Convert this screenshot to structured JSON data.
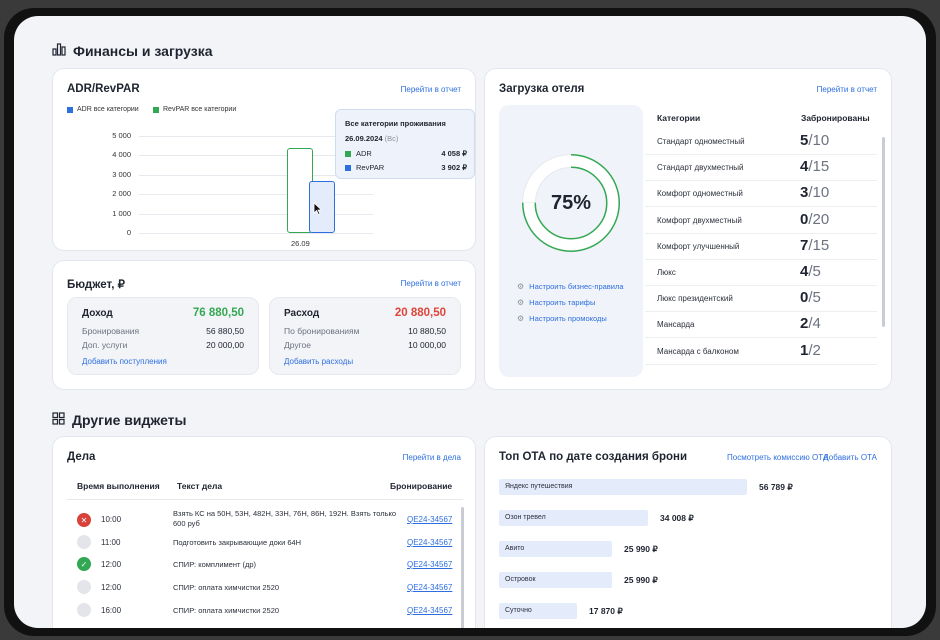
{
  "finance_section": {
    "title": "Финансы и загрузка"
  },
  "adr_card": {
    "title": "ADR/RevPAR",
    "report_link": "Перейти в отчет",
    "legend": [
      {
        "label": "ADR все категории",
        "color": "#2e6fe0"
      },
      {
        "label": "RevPAR все категории",
        "color": "#33a853"
      }
    ],
    "tooltip": {
      "title": "Все категории проживания",
      "date": "26.09.2024",
      "day": "(Вс)",
      "rows": [
        {
          "label": "ADR",
          "value": "4 058 ₽",
          "color": "#33a853"
        },
        {
          "label": "RevPAR",
          "value": "3 902 ₽",
          "color": "#2e6fe0"
        }
      ]
    }
  },
  "chart_data": {
    "type": "bar",
    "categories": [
      "26.09"
    ],
    "series": [
      {
        "name": "RevPAR все категории",
        "values": [
          4400
        ],
        "color": "#33a853"
      },
      {
        "name": "ADR все категории",
        "values": [
          2700
        ],
        "color": "#2e6fe0"
      }
    ],
    "yticks": [
      "5 000",
      "4 000",
      "3 000",
      "2 000",
      "1 000",
      "0"
    ],
    "ylim": [
      0,
      5000
    ]
  },
  "budget_card": {
    "title": "Бюджет, ₽",
    "report_link": "Перейти в отчет",
    "income": {
      "title": "Доход",
      "amount": "76 880,50",
      "rows": [
        {
          "label": "Бронирования",
          "value": "56 880,50"
        },
        {
          "label": "Доп. услуги",
          "value": "20 000,00"
        }
      ],
      "link": "Добавить поступления"
    },
    "expense": {
      "title": "Расход",
      "amount": "20 880,50",
      "rows": [
        {
          "label": "По бронированиям",
          "value": "10 880,50"
        },
        {
          "label": "Другое",
          "value": "10 000,00"
        }
      ],
      "link": "Добавить расходы"
    }
  },
  "occupancy_card": {
    "title": "Загрузка отеля",
    "report_link": "Перейти в отчет",
    "percent_label": "75%",
    "percent_value": 0.75,
    "settings_links": [
      "Настроить бизнес-правила",
      "Настроить тарифы",
      "Настроить промокоды"
    ],
    "col_categories": "Категории",
    "col_booked": "Забронированы",
    "categories": [
      {
        "name": "Стандарт одноместный",
        "booked": "5",
        "total": "/10"
      },
      {
        "name": "Стандарт двухместный",
        "booked": "4",
        "total": "/15"
      },
      {
        "name": "Комфорт одноместный",
        "booked": "3",
        "total": "/10"
      },
      {
        "name": "Комфорт двухместный",
        "booked": "0",
        "total": "/20"
      },
      {
        "name": "Комфорт улучшенный",
        "booked": "7",
        "total": "/15"
      },
      {
        "name": "Люкс",
        "booked": "4",
        "total": "/5"
      },
      {
        "name": "Люкс президентский",
        "booked": "0",
        "total": "/5"
      },
      {
        "name": "Мансарда",
        "booked": "2",
        "total": "/4"
      },
      {
        "name": "Мансарда с балконом",
        "booked": "1",
        "total": "/2"
      }
    ]
  },
  "other_section": {
    "title": "Другие виджеты"
  },
  "tasks_card": {
    "title": "Дела",
    "link": "Перейти в дела",
    "col_time": "Время выполнения",
    "col_text": "Текст дела",
    "col_booking": "Бронирование",
    "rows": [
      {
        "status": "error",
        "time": "10:00",
        "text": "Взять КС на 50Н, 53Н, 482Н, 33Н, 76Н, 86Н, 192Н. Взять только 600 руб",
        "booking": "QE24-34567"
      },
      {
        "status": "none",
        "time": "11:00",
        "text": "Подготовить закрывающие доки 64Н",
        "booking": "QE24-34567"
      },
      {
        "status": "done",
        "time": "12:00",
        "text": "СПИР: комплимент (др)",
        "booking": "QE24-34567"
      },
      {
        "status": "none",
        "time": "12:00",
        "text": "СПИР: оплата химчистки 2520",
        "booking": "QE24-34567"
      },
      {
        "status": "none",
        "time": "16:00",
        "text": "СПИР: оплата химчистки 2520",
        "booking": "QE24-34567"
      }
    ]
  },
  "ota_card": {
    "title": "Топ ОТА по дате создания брони",
    "link_commission": "Посмотреть комиссию ОТА",
    "link_add": "Добавить ОТА",
    "rows": [
      {
        "name": "Яндекс путешествия",
        "value": "56 789 ₽",
        "amount": 56789
      },
      {
        "name": "Озон тревел",
        "value": "34 008 ₽",
        "amount": 34008
      },
      {
        "name": "Авито",
        "value": "25 990 ₽",
        "amount": 25990
      },
      {
        "name": "Островок",
        "value": "25 990 ₽",
        "amount": 25990
      },
      {
        "name": "Суточно",
        "value": "17 870 ₽",
        "amount": 17870
      }
    ]
  }
}
